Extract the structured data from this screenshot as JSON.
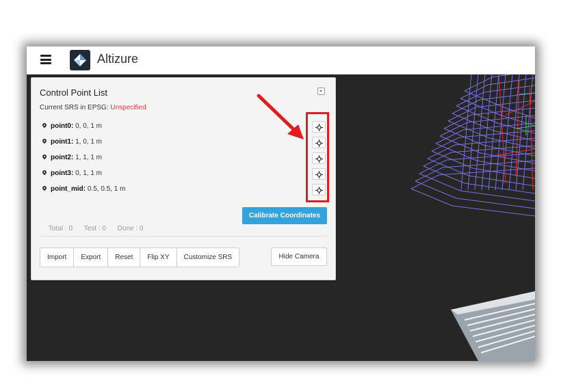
{
  "app": {
    "title": "Altizure"
  },
  "panel": {
    "title": "Control Point List",
    "srs_label": "Current SRS in EPSG:",
    "srs_value": "Unspecified",
    "points": [
      {
        "name": "point0:",
        "coords": "0, 0, 1 m"
      },
      {
        "name": "point1:",
        "coords": "1, 0, 1 m"
      },
      {
        "name": "point2:",
        "coords": "1, 1, 1 m"
      },
      {
        "name": "point3:",
        "coords": "0, 1, 1 m"
      },
      {
        "name": "point_mid:",
        "coords": "0.5, 0.5, 1 m"
      }
    ],
    "calibrate_label": "Calibrate Coordinates",
    "stats": {
      "total": "Total : 0",
      "test": "Test : 0",
      "done": "Done : 0"
    },
    "buttons": [
      "Import",
      "Export",
      "Reset",
      "Flip XY",
      "Customize SRS"
    ],
    "hide_camera_label": "Hide Camera"
  },
  "colors": {
    "accent": "#34a3dc",
    "warning_text": "#e53935",
    "annotation": "#e01c1c",
    "canvas_bg": "#262626",
    "wireframe": "#7b6fe0"
  },
  "icons": {
    "menu": "hamburger-icon",
    "logo": "altizure-logo",
    "pin": "map-pin-icon",
    "locate": "crosshair-icon",
    "collapse": "collapse-icon"
  }
}
